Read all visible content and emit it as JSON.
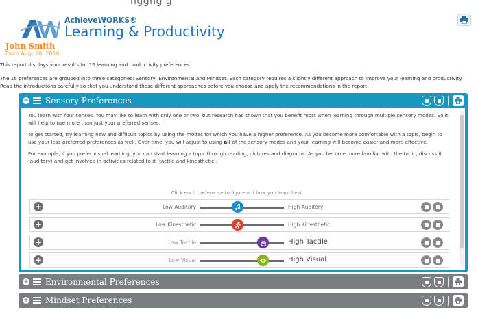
{
  "top_strip_text": "nggng g",
  "brand": {
    "small": "AchieveWORKS®",
    "big": "Learning & Productivity"
  },
  "user": {
    "name": "John Smith",
    "date": "From Aug, 28, 2018"
  },
  "intro": {
    "line1": "This report displays your results for 16 learning and productivity preferences.",
    "line2": "The 16 preferences are grouped into three categories: Sensory, Environmental and Mindset. Each category requires a slightly different approach to improve your learning and productivity. Read the introductions carefully so that you understand these different approaches before you choose and apply the recommendations in the report."
  },
  "sections": {
    "sensory": {
      "title": "Sensory Preferences",
      "para1": "You learn with four senses. You may like to learn with only one or two, but research has shown that you benefit most when learning through multiple sensory modes. So it will help to use more than just your preferred senses.",
      "para2_a": "To get started, try learning new and difficult topics by using the modes for which you have a higher preference. As you become more comfortable with a topic, begin to use your less-preferred preferences as well. Over time, you will adjust to using ",
      "para2_bold": "all",
      "para2_b": " of the sensory modes and your learning will become easier and more effective.",
      "para3": "For example, if you prefer visual learning, you can start learning a topic through reading, pictures and diagrams. As you become more familiar with the topic, discuss it (auditory) and get involved in activities related to it (tactile and kinesthetic).",
      "hint": "Click each preference to figure out how you learn best.",
      "rows": [
        {
          "low": "Low Auditory",
          "high": "High Auditory",
          "level": 0.45,
          "color": "#1b8fcf",
          "icon": "music-note-icon"
        },
        {
          "low": "Low Kinesthetic",
          "high": "High Kinesthetic",
          "level": 0.45,
          "color": "#d9432c",
          "icon": "running-figure-icon"
        },
        {
          "low": "Low Tactile",
          "high": "High Tactile",
          "level": 0.75,
          "color": "#6a3d9a",
          "icon": "hand-icon"
        },
        {
          "low": "Low Visual",
          "high": "High Visual",
          "level": 0.75,
          "color": "#8ab31f",
          "icon": "eye-icon"
        }
      ]
    },
    "environmental": {
      "title": "Environmental Preferences"
    },
    "mindset": {
      "title": "Mindset Preferences"
    }
  },
  "colors": {
    "accent": "#1a97bf",
    "collapsed_header": "#7b7d80",
    "name_orange": "#f08a1c",
    "brand_blue": "#1e73be"
  }
}
